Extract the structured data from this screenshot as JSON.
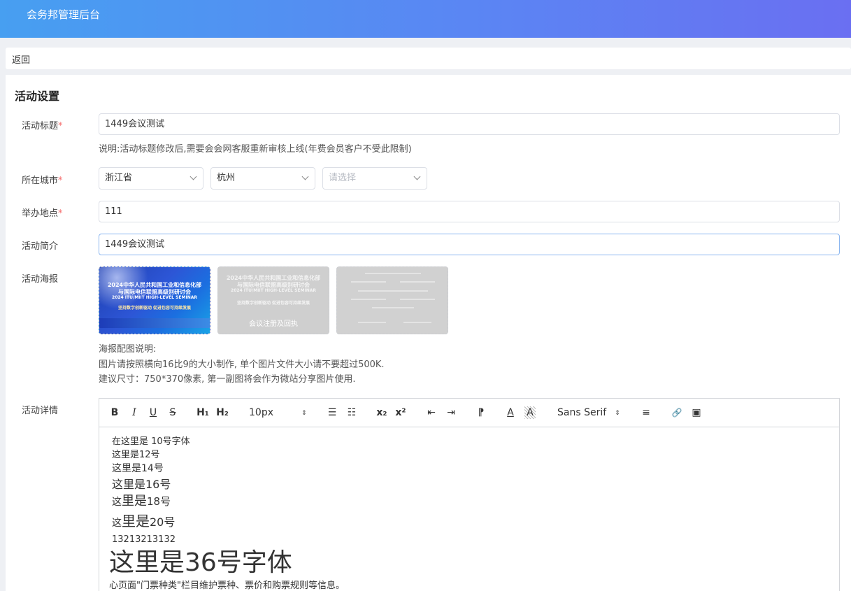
{
  "header": {
    "title": "会务邦管理后台"
  },
  "back": {
    "label": "返回"
  },
  "settings": {
    "section_title": "活动设置",
    "title_field": {
      "label": "活动标题",
      "required_mark": "*",
      "value": "1449会议测试",
      "hint": "说明:活动标题修改后,需要会会网客服重新审核上线(年费会员客户不受此限制)"
    },
    "city_field": {
      "label": "所在城市",
      "required_mark": "*",
      "province": "浙江省",
      "city": "杭州",
      "district_placeholder": "请选择"
    },
    "location_field": {
      "label": "举办地点",
      "required_mark": "*",
      "value": "111"
    },
    "intro_field": {
      "label": "活动简介",
      "value": "1449会议测试"
    },
    "poster_field": {
      "label": "活动海报",
      "posters": [
        {
          "line1": "2024中华人民共和国工业和信息化部",
          "line2": "与国际电信联盟高级别研讨会",
          "line3": "2024 ITU/MIIT HIGH-LEVEL SEMINAR",
          "line4": "坚持数字创新驱动    促进包容可持续发展"
        },
        {
          "line1": "2024中华人民共和国工业和信息化部",
          "line2": "与国际电信联盟高级别研讨会",
          "line3": "2024 ITU/MIIT HIGH-LEVEL SEMINAR",
          "line4": "坚持数字创新驱动    促进包容可持续发展",
          "line5": "会议注册及回执"
        }
      ],
      "note_title": "海报配图说明:",
      "note_line1": "图片请按照横向16比9的大小制作, 单个图片文件大小请不要超过500K.",
      "note_line2": "建议尺寸：750*370像素, 第一副图将会作为微站分享图片使用."
    },
    "detail_field": {
      "label": "活动详情",
      "toolbar": {
        "bold": "B",
        "italic": "I",
        "underline": "U",
        "strike": "S",
        "h1": "H₁",
        "h2": "H₂",
        "size": "10px",
        "ordered_list": "☰",
        "bullet_list": "☷",
        "subscript": "x₂",
        "superscript": "x²",
        "outdent": "⇤",
        "indent": "⇥",
        "direction": "⁋",
        "font_color": "A",
        "background": "A",
        "font": "Sans Serif",
        "align": "≡",
        "link": "🔗",
        "image": "▣"
      },
      "content_lines": [
        "在这里是 10号字体",
        "这里是12号",
        "这里是14号",
        "这里是16号",
        "18号",
        "20号",
        "13213213132",
        "这里是36号字体",
        "心页面\"门票种类\"栏目维护票种、票价和购票规则等信息。"
      ],
      "content_prefix_small": "这",
      "content_mid_18": "里是",
      "content_mid_20": "里是"
    }
  }
}
